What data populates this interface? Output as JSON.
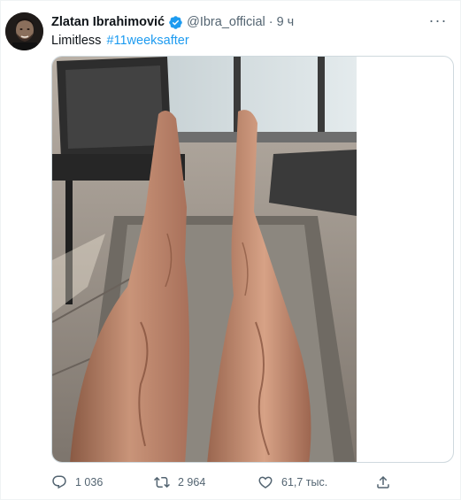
{
  "tweet": {
    "author_name": "Zlatan Ibrahimović",
    "handle": "@Ibra_official",
    "separator": "·",
    "timestamp": "9 ч",
    "text": "Limitless",
    "hashtag": "#11weeksafter",
    "menu_glyph": "···"
  },
  "actions": {
    "replies": "1 036",
    "retweets": "2 964",
    "likes": "61,7 тыс."
  },
  "colors": {
    "accent": "#1d9bf0",
    "secondary_text": "#536471",
    "primary_text": "#0f1419",
    "border": "#cfd9de"
  },
  "icons": [
    "verified-badge-icon",
    "more-options-icon",
    "reply-icon",
    "retweet-icon",
    "like-icon",
    "share-icon"
  ]
}
